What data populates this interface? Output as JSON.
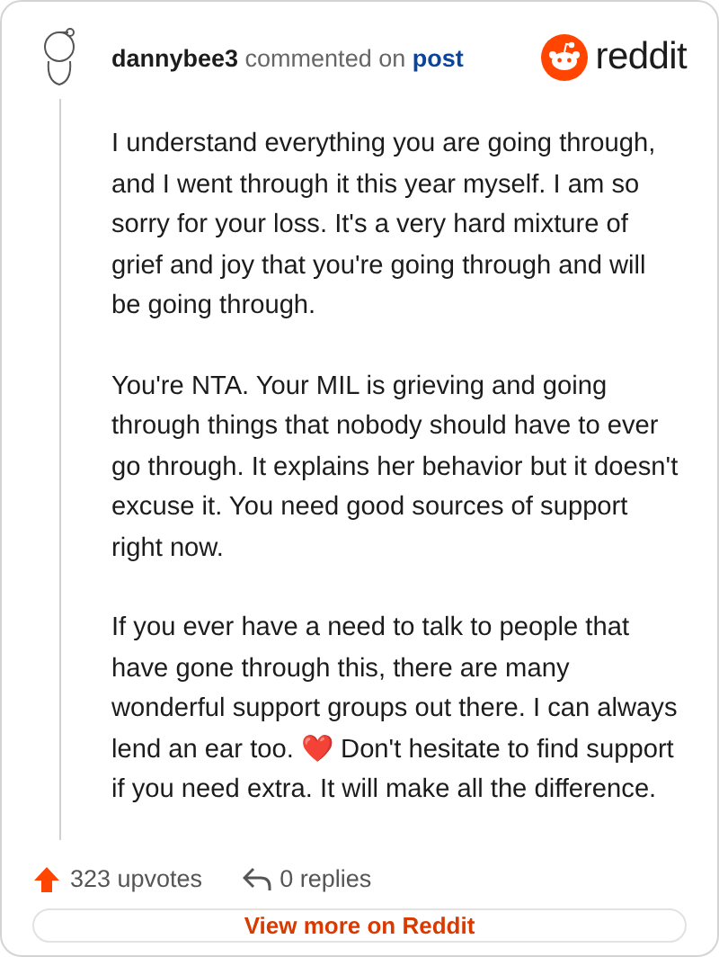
{
  "comment": {
    "author": "dannybee3",
    "action": "commented on",
    "link": "post",
    "paragraphs": [
      "I understand everything you are going through, and I went through it this year myself. I am so sorry for your loss. It's a very hard mixture of grief and joy that you're going through and will be going through.",
      "You're NTA. Your MIL is grieving and going through things that nobody should have to ever go through. It explains her behavior but it doesn't excuse it. You need good sources of support right now.",
      "If you ever have a need to talk to people that have gone through this, there are many wonderful support groups out there. I can always lend an ear too. ❤️ Don't hesitate to find support if you need extra. It will make all the difference."
    ]
  },
  "brand": "reddit",
  "stats": {
    "upvotes": "323 upvotes",
    "replies": "0 replies"
  },
  "button": "View more on Reddit"
}
